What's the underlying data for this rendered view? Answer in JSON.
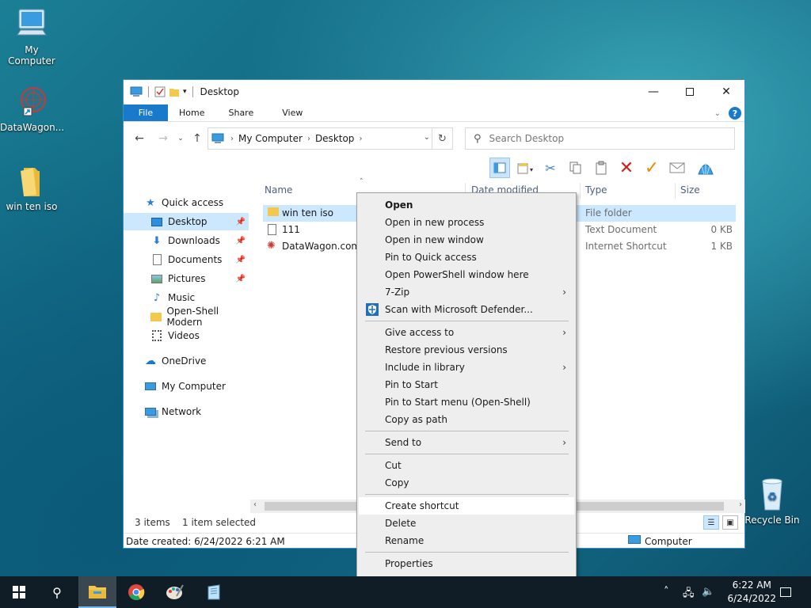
{
  "desktop": {
    "icons": [
      {
        "label": "My Computer"
      },
      {
        "label": "DataWagon..."
      },
      {
        "label": "win ten iso"
      },
      {
        "label": "Recycle Bin"
      }
    ]
  },
  "window": {
    "title": "Desktop",
    "ribbon_tabs": [
      "File",
      "Home",
      "Share",
      "View"
    ],
    "address": {
      "crumbs": [
        "My Computer",
        "Desktop"
      ]
    },
    "search": {
      "placeholder": "Search Desktop"
    }
  },
  "nav": {
    "items": [
      {
        "label": "Quick access"
      },
      {
        "label": "Desktop"
      },
      {
        "label": "Downloads"
      },
      {
        "label": "Documents"
      },
      {
        "label": "Pictures"
      },
      {
        "label": "Music"
      },
      {
        "label": "Open-Shell Modern"
      },
      {
        "label": "Videos"
      },
      {
        "label": "OneDrive"
      },
      {
        "label": "My Computer"
      },
      {
        "label": "Network"
      }
    ]
  },
  "columns": {
    "name": "Name",
    "date": "Date modified",
    "type": "Type",
    "size": "Size"
  },
  "files": [
    {
      "name": "win ten iso",
      "type": "File folder",
      "size": ""
    },
    {
      "name": "111",
      "type": "Text Document",
      "size": "0 KB"
    },
    {
      "name": "DataWagon.com",
      "type": "Internet Shortcut",
      "size": "1 KB"
    }
  ],
  "status": {
    "count": "3 items",
    "selected": "1 item selected"
  },
  "details": {
    "created": "Date created: 6/24/2022 6:21 AM",
    "location": "Computer"
  },
  "context_menu": {
    "items": [
      {
        "label": "Open"
      },
      {
        "label": "Open in new process"
      },
      {
        "label": "Open in new window"
      },
      {
        "label": "Pin to Quick access"
      },
      {
        "label": "Open PowerShell window here"
      },
      {
        "label": "7-Zip"
      },
      {
        "label": "Scan with Microsoft Defender..."
      },
      {
        "label": "Give access to"
      },
      {
        "label": "Restore previous versions"
      },
      {
        "label": "Include in library"
      },
      {
        "label": "Pin to Start"
      },
      {
        "label": "Pin to Start menu (Open-Shell)"
      },
      {
        "label": "Copy as path"
      },
      {
        "label": "Send to"
      },
      {
        "label": "Cut"
      },
      {
        "label": "Copy"
      },
      {
        "label": "Create shortcut"
      },
      {
        "label": "Delete"
      },
      {
        "label": "Rename"
      },
      {
        "label": "Properties"
      }
    ]
  },
  "taskbar": {
    "time": "6:22 AM",
    "date": "6/24/2022"
  },
  "colors": {
    "accent": "#1979ca",
    "selection": "#cce8ff",
    "taskbar": "#101c26"
  }
}
